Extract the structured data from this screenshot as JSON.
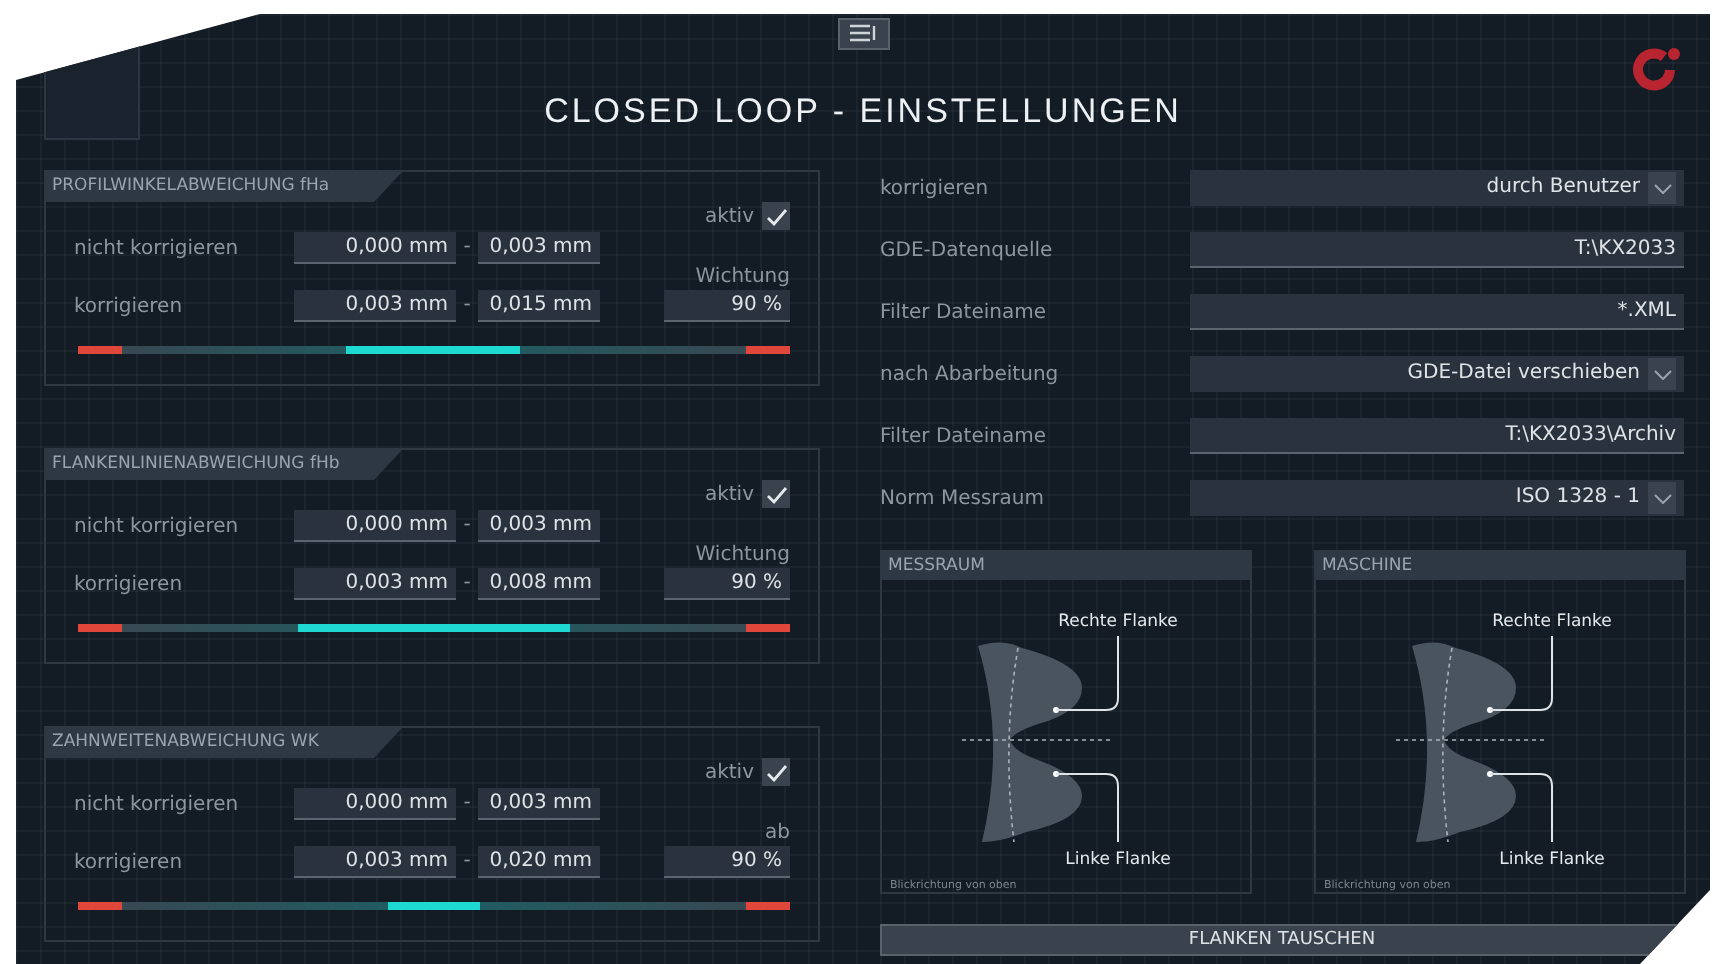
{
  "title": "CLOSED LOOP - EINSTELLUNGEN",
  "sections": [
    {
      "title": "PROFILWINKELABWEICHUNG fHa",
      "active": {
        "label": "aktiv",
        "checked": true
      },
      "rows": [
        {
          "label": "nicht korrigieren",
          "from": "0,000 mm",
          "separator": "-",
          "to": "0,003 mm"
        },
        {
          "label": "korrigieren",
          "from": "0,003 mm",
          "separator": "-",
          "to": "0,015 mm"
        }
      ],
      "weight": {
        "label": "Wichtung",
        "value": "90 %"
      },
      "bar": {
        "start": {
          "level": 0.375
        },
        "end": {
          "level": 0.62
        }
      }
    },
    {
      "title": "FLANKENLINIENABWEICHUNG fHb",
      "active": {
        "label": "aktiv",
        "checked": true
      },
      "rows": [
        {
          "label": "nicht korrigieren",
          "from": "0,000 mm",
          "separator": "-",
          "to": "0,003 mm"
        },
        {
          "label": "korrigieren",
          "from": "0,003 mm",
          "separator": "-",
          "to": "0,008 mm"
        }
      ],
      "weight": {
        "label": "Wichtung",
        "value": "90 %"
      },
      "bar": {
        "start": {
          "level": 0.31
        },
        "end": {
          "level": 0.69
        }
      }
    },
    {
      "title": "ZAHNWEITENABWEICHUNG WK",
      "active": {
        "label": "aktiv",
        "checked": true
      },
      "rows": [
        {
          "label": "nicht korrigieren",
          "from": "0,000 mm",
          "separator": "-",
          "to": "0,003 mm"
        },
        {
          "label": "korrigieren",
          "from": "0,003 mm",
          "separator": "-",
          "to": "0,020 mm"
        }
      ],
      "weight": {
        "label": "ab",
        "value": "90 %"
      },
      "bar": {
        "start": {
          "level": 0.435
        },
        "end": {
          "level": 0.565
        }
      }
    }
  ],
  "settings": [
    {
      "label": "korrigieren",
      "value": "durch Benutzer",
      "kind": "dropdown"
    },
    {
      "label": "GDE-Datenquelle",
      "value": "T:\\KX2033",
      "kind": "text"
    },
    {
      "label": "Filter Dateiname",
      "value": "*.XML",
      "kind": "text"
    },
    {
      "label": "nach Abarbeitung",
      "value": "GDE-Datei verschieben",
      "kind": "dropdown"
    },
    {
      "label": "Filter Dateiname",
      "value": "T:\\KX2033\\Archiv",
      "kind": "text"
    },
    {
      "label": "Norm Messraum",
      "value": "ISO 1328 - 1",
      "kind": "dropdown"
    }
  ],
  "diagrams": [
    {
      "title": "MESSRAUM",
      "top_label": "Rechte Flanke",
      "bottom_label": "Linke Flanke",
      "caption": "Blickrichtung von oben"
    },
    {
      "title": "MASCHINE",
      "top_label": "Rechte Flanke",
      "bottom_label": "Linke Flanke",
      "caption": "Blickrichtung von oben"
    }
  ],
  "swap_button": "FLANKEN TAUSCHEN"
}
